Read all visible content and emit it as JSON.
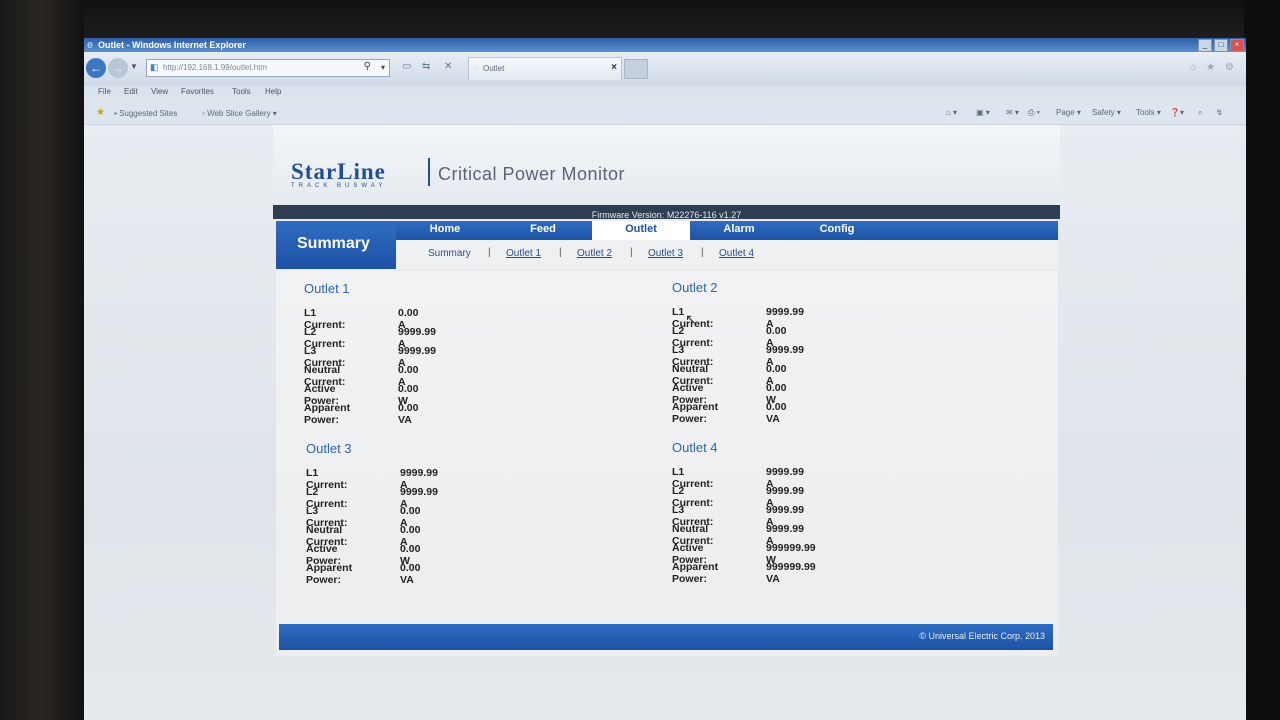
{
  "browser": {
    "title": "Outlet - Windows Internet Explorer",
    "url": "http://192.168.1.99/outlet.htm",
    "tab_label": "Outlet",
    "menu": [
      "File",
      "Edit",
      "View",
      "Favorites",
      "Tools",
      "Help"
    ],
    "favorites": [
      "Suggested Sites",
      "Web Slice Gallery"
    ],
    "commands": [
      "Page",
      "Safety",
      "Tools"
    ]
  },
  "app": {
    "logo": "StarLine",
    "logo_sub": "TRACK BUSWAY",
    "title": "Critical Power Monitor",
    "firmware": "Firmware Version: M22276-116 v1.27",
    "section": "Summary",
    "nav": [
      "Home",
      "Feed",
      "Outlet",
      "Alarm",
      "Config"
    ],
    "active_nav": "Outlet",
    "subnav": [
      "Summary",
      "Outlet 1",
      "Outlet 2",
      "Outlet 3",
      "Outlet 4"
    ],
    "footer": "© Universal Electric Corp. 2013"
  },
  "labels": {
    "l1": "L1 Current:",
    "l2": "L2 Current:",
    "l3": "L3 Current:",
    "neutral": "Neutral Current:",
    "active": "Active Power:",
    "apparent": "Apparent Power:"
  },
  "outlets": [
    {
      "name": "Outlet 1",
      "l1": "0.00 A",
      "l2": "9999.99 A",
      "l3": "9999.99 A",
      "neutral": "0.00 A",
      "active": "0.00 W",
      "apparent": "0.00 VA"
    },
    {
      "name": "Outlet 2",
      "l1": "9999.99 A",
      "l2": "0.00 A",
      "l3": "9999.99 A",
      "neutral": "0.00 A",
      "active": "0.00 W",
      "apparent": "0.00 VA"
    },
    {
      "name": "Outlet 3",
      "l1": "9999.99 A",
      "l2": "9999.99 A",
      "l3": "0.00 A",
      "neutral": "0.00 A",
      "active": "0.00 W",
      "apparent": "0.00 VA"
    },
    {
      "name": "Outlet 4",
      "l1": "9999.99 A",
      "l2": "9999.99 A",
      "l3": "9999.99 A",
      "neutral": "9999.99 A",
      "active": "999999.99 W",
      "apparent": "999999.99 VA"
    }
  ]
}
